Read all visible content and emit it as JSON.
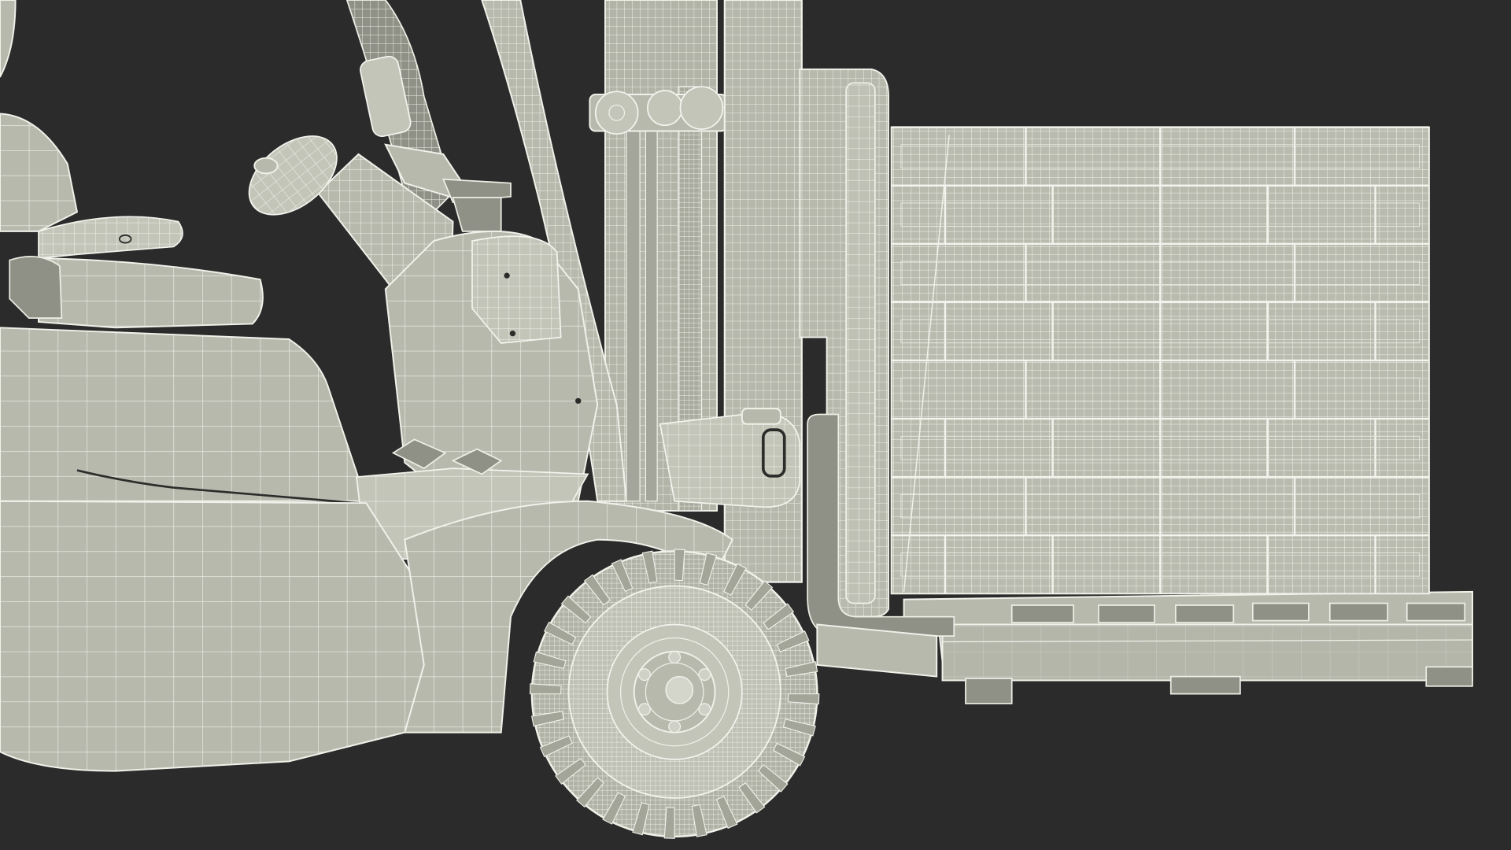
{
  "scene": {
    "subject": "forklift-with-loaded-pallet",
    "render_style": "wireframe",
    "colors": {
      "background": "#2b2b2b",
      "surface": "#b7b9ad",
      "surface_dark": "#8f9186",
      "wire": "#f1f1ea"
    }
  }
}
